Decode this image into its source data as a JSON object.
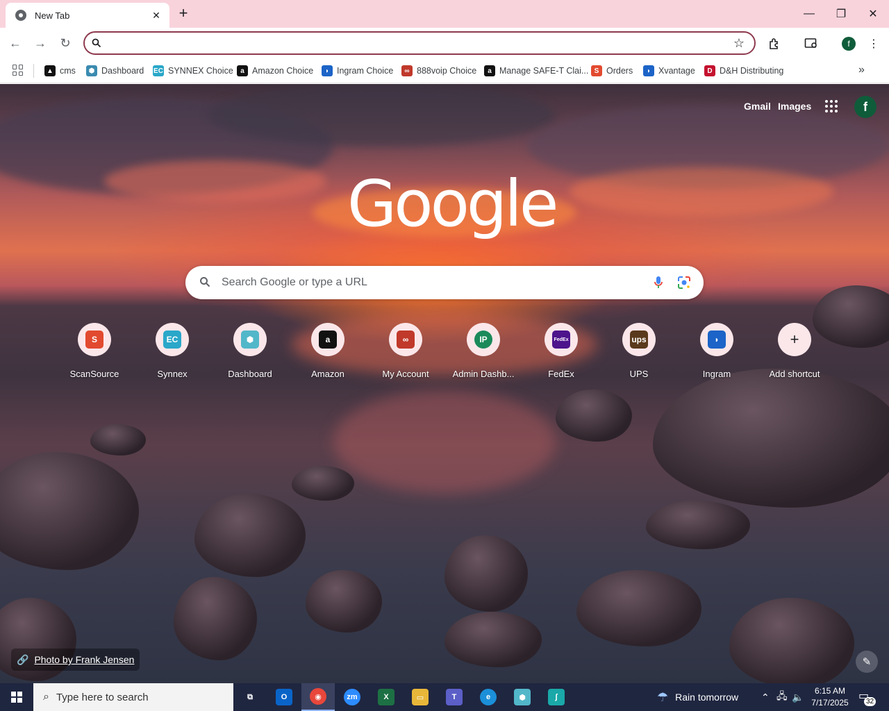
{
  "tab": {
    "title": "New Tab",
    "close_icon": "close-icon"
  },
  "window": {
    "minimize": "—",
    "restore": "❐",
    "close": "✕"
  },
  "toolbar": {
    "omnibox_value": "",
    "omnibox_placeholder": ""
  },
  "bookmarks": [
    {
      "label": "cms",
      "icon_color": "#111111",
      "glyph": "▲"
    },
    {
      "label": "Dashboard",
      "icon_color": "#3b8bb0",
      "glyph": "⬢"
    },
    {
      "label": "SYNNEX Choice",
      "icon_color": "#2aa7c9",
      "glyph": "EC"
    },
    {
      "label": "Amazon Choice",
      "icon_color": "#111111",
      "glyph": "a"
    },
    {
      "label": "Ingram Choice",
      "icon_color": "#1c64c7",
      "glyph": "◗"
    },
    {
      "label": "888voip Choice",
      "icon_color": "#c0392b",
      "glyph": "∞"
    },
    {
      "label": "Manage SAFE-T Clai...",
      "icon_color": "#111111",
      "glyph": "a"
    },
    {
      "label": "Orders",
      "icon_color": "#e24a2f",
      "glyph": "S"
    },
    {
      "label": "Xvantage",
      "icon_color": "#1c64c7",
      "glyph": "◗"
    },
    {
      "label": "D&H Distributing",
      "icon_color": "#c4122f",
      "glyph": "D"
    }
  ],
  "ntp": {
    "gmail": "Gmail",
    "images": "Images",
    "avatar_letter": "f",
    "logo": "Google",
    "search_placeholder": "Search Google or type a URL",
    "photo_credit": "Photo by Frank Jensen"
  },
  "shortcuts": [
    {
      "label": "ScanSource",
      "icon_color": "#e24a2f",
      "glyph": "S"
    },
    {
      "label": "Synnex",
      "icon_color": "#2aa7c9",
      "glyph": "EC"
    },
    {
      "label": "Dashboard",
      "icon_color": "#52b7c9",
      "glyph": "⬢"
    },
    {
      "label": "Amazon",
      "icon_color": "#111111",
      "glyph": "a"
    },
    {
      "label": "My Account",
      "icon_color": "#c0392b",
      "glyph": "∞"
    },
    {
      "label": "Admin Dashb...",
      "icon_color": "#1b8a5a",
      "glyph": "IP"
    },
    {
      "label": "FedEx",
      "icon_color": "#4d148c",
      "glyph": "FedEx"
    },
    {
      "label": "UPS",
      "icon_color": "#5a3a1c",
      "glyph": "ups"
    },
    {
      "label": "Ingram",
      "icon_color": "#1c64c7",
      "glyph": "◗"
    },
    {
      "label": "Add shortcut",
      "icon_color": "#fbe7ea",
      "glyph": "+"
    }
  ],
  "taskbar": {
    "search_placeholder": "Type here to search",
    "weather": "Rain tomorrow",
    "time": "6:15 AM",
    "date": "7/17/2025",
    "notifications": "32",
    "apps": [
      {
        "name": "task-view",
        "color": "#1f2640",
        "glyph": "⧉"
      },
      {
        "name": "outlook",
        "color": "#0a64c8",
        "glyph": "O"
      },
      {
        "name": "chrome",
        "color": "#e9473b",
        "glyph": "◉"
      },
      {
        "name": "zoom",
        "color": "#2d8cff",
        "glyph": "zm"
      },
      {
        "name": "excel",
        "color": "#1d7044",
        "glyph": "X"
      },
      {
        "name": "file-explorer",
        "color": "#e8b73a",
        "glyph": "▭"
      },
      {
        "name": "teams",
        "color": "#5b5fc7",
        "glyph": "T"
      },
      {
        "name": "edge",
        "color": "#1b8fd8",
        "glyph": "e"
      },
      {
        "name": "dashboard-app",
        "color": "#52b7c9",
        "glyph": "⬢"
      },
      {
        "name": "scansource-app",
        "color": "#1aa8a8",
        "glyph": "ʃ"
      }
    ]
  }
}
